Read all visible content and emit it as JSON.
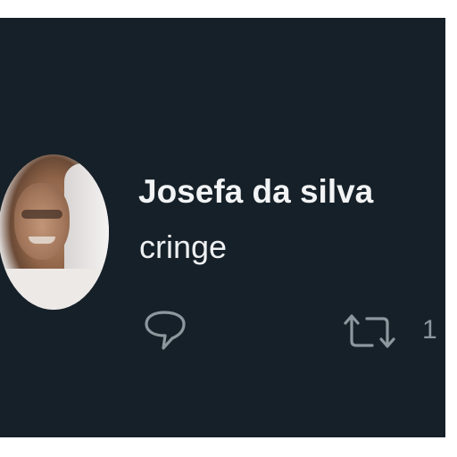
{
  "tweet": {
    "author_name": "Josefa da silva",
    "text": "cringe",
    "retweet_count": "1"
  },
  "icons": {
    "avatar": "avatar-photo",
    "reply": "reply-icon",
    "retweet": "retweet-icon"
  },
  "colors": {
    "background": "#162028",
    "primary_text": "#f1f3f4",
    "icon_gray": "#8d979e"
  }
}
